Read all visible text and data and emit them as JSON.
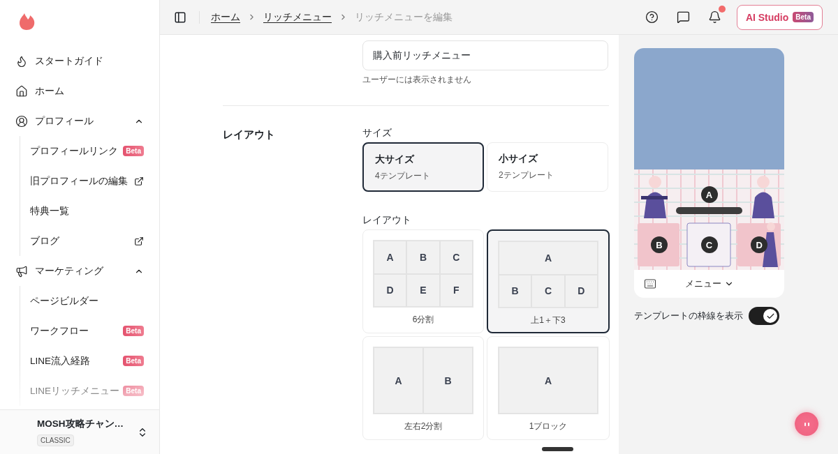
{
  "sidebar": {
    "items": [
      {
        "kind": "link",
        "label": "スタートガイド"
      },
      {
        "kind": "link",
        "label": "ホーム"
      },
      {
        "kind": "group",
        "label": "プロフィール",
        "expanded": true,
        "children": [
          {
            "label": "プロフィールリンク",
            "badge": "Beta"
          },
          {
            "label": "旧プロフィールの編集",
            "external": true
          },
          {
            "label": "特典一覧"
          },
          {
            "label": "ブログ",
            "external": true
          }
        ]
      },
      {
        "kind": "group",
        "label": "マーケティング",
        "expanded": true,
        "children": [
          {
            "label": "ページビルダー"
          },
          {
            "label": "ワークフロー",
            "badge": "Beta"
          },
          {
            "label": "LINE流入経路",
            "badge": "Beta"
          },
          {
            "label": "LINEリッチメニュー",
            "badge": "Beta"
          }
        ]
      }
    ],
    "account": {
      "name": "MOSH攻略チャン…",
      "plan": "CLASSIC"
    }
  },
  "header": {
    "breadcrumbs": [
      {
        "label": "ホーム",
        "link": true
      },
      {
        "label": "リッチメニュー",
        "link": true
      },
      {
        "label": "リッチメニューを編集",
        "link": false
      }
    ],
    "notification": true,
    "ai_button": {
      "label": "AI Studio",
      "badge": "Beta"
    }
  },
  "form": {
    "name_field": {
      "value": "購入前リッチメニュー",
      "hint": "ユーザーには表示されません"
    },
    "layout_section": {
      "title": "レイアウト",
      "size_label": "サイズ",
      "sizes": [
        {
          "title": "大サイズ",
          "sub": "4テンプレート",
          "selected": true
        },
        {
          "title": "小サイズ",
          "sub": "2テンプレート",
          "selected": false
        }
      ],
      "layout_label": "レイアウト",
      "layouts": [
        {
          "label": "6分割",
          "rows": [
            [
              "A",
              "B",
              "C"
            ],
            [
              "D",
              "E",
              "F"
            ]
          ],
          "selected": false
        },
        {
          "label": "上1＋下3",
          "rows": [
            [
              {
                "text": "A",
                "colspan": 3
              }
            ],
            [
              "B",
              "C",
              "D"
            ]
          ],
          "selected": true
        },
        {
          "label": "左右2分割",
          "rows": [
            [
              "A",
              "B"
            ]
          ],
          "selected": false
        },
        {
          "label": "1ブロック",
          "rows": [
            [
              "A"
            ]
          ],
          "selected": false
        }
      ]
    }
  },
  "preview": {
    "regions": [
      [
        "A"
      ],
      [
        "B",
        "C",
        "D"
      ]
    ],
    "menu_label": "メニュー",
    "toggle": {
      "label": "テンプレートの枠線を表示",
      "on": true
    }
  }
}
